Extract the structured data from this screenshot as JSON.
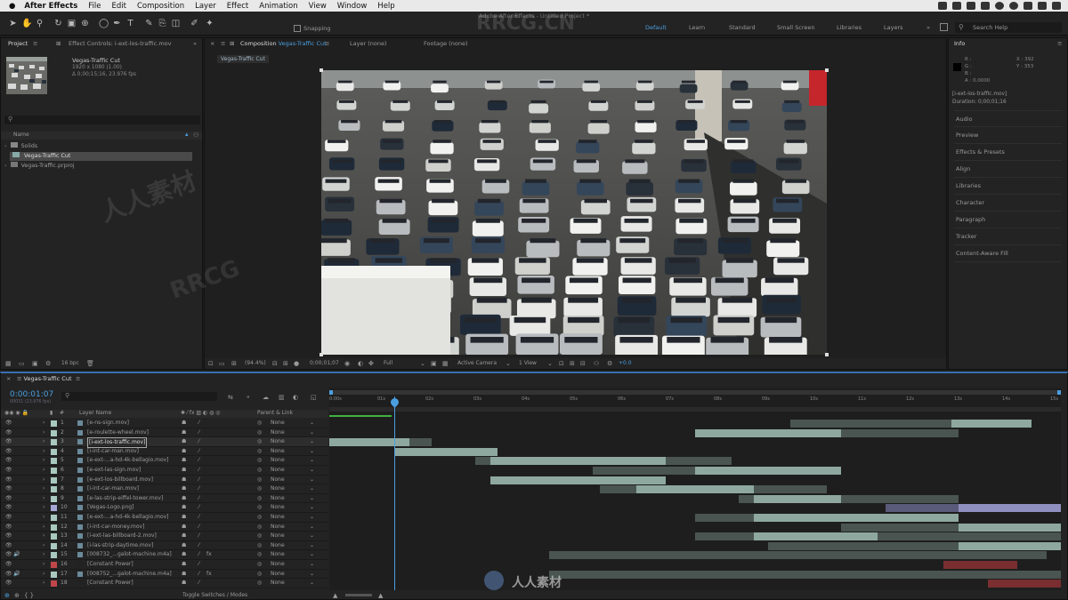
{
  "menubar": {
    "app": "After Effects",
    "items": [
      "File",
      "Edit",
      "Composition",
      "Layer",
      "Effect",
      "Animation",
      "View",
      "Window",
      "Help"
    ]
  },
  "toolbar": {
    "snapping": "Snapping",
    "title": "Adobe After Effects - Untitled Project *",
    "workspaces": [
      "Default",
      "Learn",
      "Standard",
      "Small Screen",
      "Libraries",
      "Layers"
    ],
    "search_placeholder": "Search Help"
  },
  "project": {
    "tab": "Project",
    "effect_tab": "Effect Controls: i-ext-los-traffic.mov",
    "item_name": "Vegas-Traffic Cut",
    "item_details": [
      "1920 x 1080 (1.00)",
      "Δ 0;00;15;16, 23.976 fps"
    ],
    "column": "Name",
    "items": [
      {
        "name": "Solids",
        "type": "folder"
      },
      {
        "name": "Vegas-Traffic Cut",
        "type": "comp"
      },
      {
        "name": "Vegas-Traffic.prproj",
        "type": "project"
      }
    ],
    "bpc": "16 bpc"
  },
  "viewer": {
    "tabs": {
      "composition": "Composition",
      "comp_name": "Vegas-Traffic Cut",
      "layer": "Layer (none)",
      "footage": "Footage (none)"
    },
    "nav": "Vegas-Traffic Cut",
    "zoom": "(94.4%)",
    "timecode": "0;00;01;07",
    "resolution": "Full",
    "camera": "Active Camera",
    "view": "1 View",
    "offset": "+0.0"
  },
  "info": {
    "tab": "Info",
    "channels": [
      "R :",
      "G :",
      "B :",
      "A : 0.0000"
    ],
    "coords": [
      "X : 392",
      "Y : 353"
    ],
    "layer": "[i-ext-los-traffic.mov]",
    "duration": "Duration: 0;00;01;16",
    "panels": [
      "Audio",
      "Preview",
      "Effects & Presets",
      "Align",
      "Libraries",
      "Character",
      "Paragraph",
      "Tracker",
      "Content-Aware Fill"
    ]
  },
  "timeline": {
    "tab": "Vegas-Traffic Cut",
    "timecode": "0:00:01:07",
    "fps": "00031 (23.976 fps)",
    "columns": {
      "num": "#",
      "name": "Layer Name",
      "parent": "Parent & Link"
    },
    "parent_value": "None",
    "toggle": "Toggle Switches / Modes",
    "ruler": [
      "0:00s",
      "01s",
      "02s",
      "03s",
      "04s",
      "05s",
      "06s",
      "07s",
      "08s",
      "09s",
      "10s",
      "11s",
      "12s",
      "13s",
      "14s",
      "15s"
    ],
    "layers": [
      {
        "num": "1",
        "name": "[e-ns-sign.mov]",
        "color": "#a9c8bf",
        "audio": false,
        "fx": false,
        "start": 0.63,
        "end": 0.96,
        "light_start": 0.85,
        "light_end": 0.96
      },
      {
        "num": "2",
        "name": "[e-roulette-wheel.mov]",
        "color": "#a9c8bf",
        "audio": false,
        "fx": false,
        "start": 0.63,
        "end": 0.86,
        "light_start": 0.5,
        "light_end": 0.7
      },
      {
        "num": "3",
        "name": "[i-ext-los-traffic.mov]",
        "color": "#a9c8bf",
        "audio": false,
        "fx": false,
        "start": 0.0,
        "end": 0.14,
        "light_start": 0.0,
        "light_end": 0.11
      },
      {
        "num": "4",
        "name": "[i-int-car-man.mov]",
        "color": "#a9c8bf",
        "audio": false,
        "fx": false,
        "start": 0.09,
        "end": 0.23,
        "light_start": 0.09,
        "light_end": 0.23
      },
      {
        "num": "5",
        "name": "[e-ext-...a-hd-4k-bellagio.mov]",
        "color": "#a9c8bf",
        "audio": false,
        "fx": false,
        "start": 0.2,
        "end": 0.55,
        "light_start": 0.22,
        "light_end": 0.46
      },
      {
        "num": "6",
        "name": "[e-ext-las-sign.mov]",
        "color": "#a9c8bf",
        "audio": false,
        "fx": false,
        "start": 0.36,
        "end": 0.5,
        "light_start": 0.5,
        "light_end": 0.7
      },
      {
        "num": "7",
        "name": "[e-ext-los-billboard.mov]",
        "color": "#a9c8bf",
        "audio": false,
        "fx": false,
        "start": 0.22,
        "end": 0.46,
        "light_start": 0.22,
        "light_end": 0.46
      },
      {
        "num": "8",
        "name": "[i-int-car-man.mov]",
        "color": "#a9c8bf",
        "audio": false,
        "fx": false,
        "start": 0.37,
        "end": 0.68,
        "light_start": 0.42,
        "light_end": 0.58
      },
      {
        "num": "9",
        "name": "[e-las-strip-eiffel-tower.mov]",
        "color": "#a9c8bf",
        "audio": false,
        "fx": false,
        "start": 0.56,
        "end": 0.86,
        "light_start": 0.58,
        "light_end": 0.7
      },
      {
        "num": "10",
        "name": "[Vegas-Logo.png]",
        "color": "#a6a6d6",
        "audio": false,
        "fx": false,
        "start": 0.76,
        "end": 1.0,
        "light_start": 0.86,
        "light_end": 1.0
      },
      {
        "num": "11",
        "name": "[e-ext-...a-hd-4k-bellagio.mov]",
        "color": "#a9c8bf",
        "audio": false,
        "fx": false,
        "start": 0.5,
        "end": 0.86,
        "light_start": 0.58,
        "light_end": 0.86
      },
      {
        "num": "12",
        "name": "[i-int-car-money.mov]",
        "color": "#a9c8bf",
        "audio": false,
        "fx": false,
        "start": 0.7,
        "end": 1.0,
        "light_start": 0.86,
        "light_end": 1.0
      },
      {
        "num": "13",
        "name": "[i-ext-las-billboard-2.mov]",
        "color": "#a9c8bf",
        "audio": false,
        "fx": false,
        "start": 0.5,
        "end": 1.0,
        "light_start": 0.58,
        "light_end": 0.75
      },
      {
        "num": "14",
        "name": "[i-las-strip-daytime.mov]",
        "color": "#a9c8bf",
        "audio": false,
        "fx": false,
        "start": 0.6,
        "end": 1.0,
        "light_start": 0.86,
        "light_end": 1.0
      },
      {
        "num": "15",
        "name": "[008732_...galot-machine.m4a]",
        "color": "#a9c8bf",
        "audio": true,
        "fx": true,
        "start": 0.3,
        "end": 0.98,
        "light_start": 0,
        "light_end": 0
      },
      {
        "num": "16",
        "name": "[Constant Power]",
        "color": "#c0464a",
        "audio": false,
        "fx": false,
        "start": 0.84,
        "end": 0.94,
        "light_start": 0,
        "light_end": 0
      },
      {
        "num": "17",
        "name": "[008752_...galot-machine.m4a]",
        "color": "#a9c8bf",
        "audio": true,
        "fx": true,
        "start": 0.3,
        "end": 1.0,
        "light_start": 0,
        "light_end": 0
      },
      {
        "num": "18",
        "name": "[Constant Power]",
        "color": "#c0464a",
        "audio": false,
        "fx": false,
        "start": 0.9,
        "end": 1.0,
        "light_start": 0,
        "light_end": 0
      }
    ]
  },
  "watermarks": [
    "RRCG.CN",
    "人人素材",
    "RRCG",
    "人人素材"
  ]
}
